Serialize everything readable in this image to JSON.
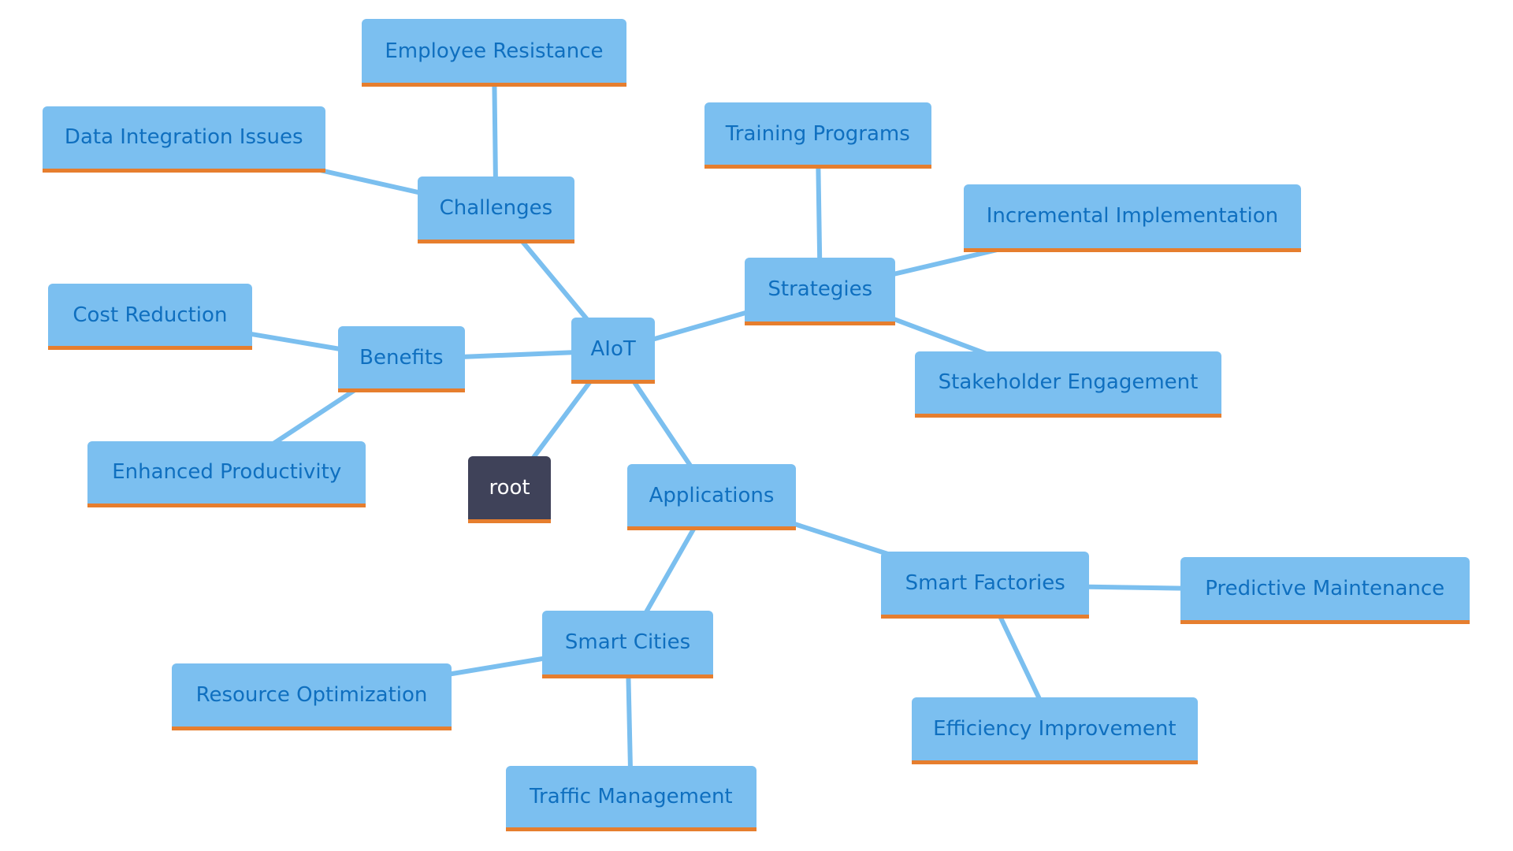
{
  "colors": {
    "node_fill": "#7bbff0",
    "node_text": "#0f6fbf",
    "node_border": "#e67e2e",
    "edge": "#7bbfef",
    "root_fill": "#3f4259",
    "root_text": "#ffffff"
  },
  "nodes": [
    {
      "id": "aiot",
      "label": "AIoT"
    },
    {
      "id": "root",
      "label": "root"
    },
    {
      "id": "challenges",
      "label": "Challenges"
    },
    {
      "id": "employee-resistance",
      "label": "Employee Resistance"
    },
    {
      "id": "data-integration-issues",
      "label": "Data Integration Issues"
    },
    {
      "id": "strategies",
      "label": "Strategies"
    },
    {
      "id": "training-programs",
      "label": "Training Programs"
    },
    {
      "id": "incremental-implementation",
      "label": "Incremental Implementation"
    },
    {
      "id": "stakeholder-engagement",
      "label": "Stakeholder Engagement"
    },
    {
      "id": "benefits",
      "label": "Benefits"
    },
    {
      "id": "cost-reduction",
      "label": "Cost Reduction"
    },
    {
      "id": "enhanced-productivity",
      "label": "Enhanced Productivity"
    },
    {
      "id": "applications",
      "label": "Applications"
    },
    {
      "id": "smart-factories",
      "label": "Smart Factories"
    },
    {
      "id": "predictive-maintenance",
      "label": "Predictive Maintenance"
    },
    {
      "id": "efficiency-improvement",
      "label": "Efficiency Improvement"
    },
    {
      "id": "smart-cities",
      "label": "Smart Cities"
    },
    {
      "id": "resource-optimization",
      "label": "Resource Optimization"
    },
    {
      "id": "traffic-management",
      "label": "Traffic Management"
    }
  ],
  "edges": [
    [
      "aiot",
      "challenges"
    ],
    [
      "challenges",
      "employee-resistance"
    ],
    [
      "challenges",
      "data-integration-issues"
    ],
    [
      "aiot",
      "strategies"
    ],
    [
      "strategies",
      "training-programs"
    ],
    [
      "strategies",
      "incremental-implementation"
    ],
    [
      "strategies",
      "stakeholder-engagement"
    ],
    [
      "aiot",
      "benefits"
    ],
    [
      "benefits",
      "cost-reduction"
    ],
    [
      "benefits",
      "enhanced-productivity"
    ],
    [
      "aiot",
      "root"
    ],
    [
      "aiot",
      "applications"
    ],
    [
      "applications",
      "smart-factories"
    ],
    [
      "smart-factories",
      "predictive-maintenance"
    ],
    [
      "smart-factories",
      "efficiency-improvement"
    ],
    [
      "applications",
      "smart-cities"
    ],
    [
      "smart-cities",
      "resource-optimization"
    ],
    [
      "smart-cities",
      "traffic-management"
    ]
  ]
}
